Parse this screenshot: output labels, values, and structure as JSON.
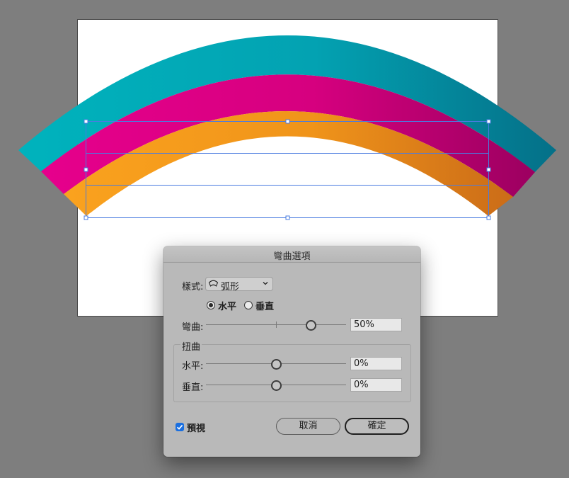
{
  "canvas": {
    "colors": {
      "background": "#7e7e7e",
      "band_outer": [
        "#00b3bd",
        "#047088"
      ],
      "band_middle": [
        "#e6008c",
        "#9c0060"
      ],
      "band_inner": [
        "#faa21e",
        "#cb6c18"
      ],
      "selection": "#4a7ce0"
    }
  },
  "dialog": {
    "title": "彎曲選項",
    "style_label": "樣式:",
    "style_value": "弧形",
    "style_icon": "arc-style-icon",
    "orientation": {
      "horizontal_label": "水平",
      "vertical_label": "垂直",
      "selected": "horizontal"
    },
    "bend": {
      "label": "彎曲:",
      "value": "50%",
      "level": 0.5
    },
    "distortion": {
      "group_label": "扭曲",
      "horizontal": {
        "label": "水平:",
        "value": "0%",
        "level": 0
      },
      "vertical": {
        "label": "垂直:",
        "value": "0%",
        "level": 0
      }
    },
    "preview": {
      "label": "預視",
      "checked": true
    },
    "cancel_label": "取消",
    "ok_label": "確定"
  }
}
